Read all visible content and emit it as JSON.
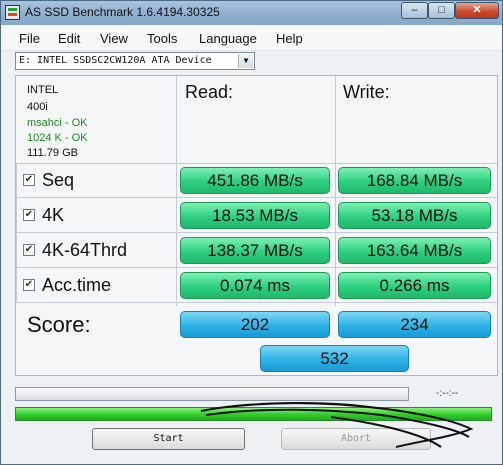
{
  "window": {
    "title": "AS SSD Benchmark 1.6.4194.30325",
    "controls": {
      "minimize": "–",
      "maximize": "□",
      "close": "✕"
    }
  },
  "menu": [
    "File",
    "Edit",
    "View",
    "Tools",
    "Language",
    "Help"
  ],
  "device_select": {
    "value": "E: INTEL SSDSC2CW120A ATA Device",
    "arrow": "▼"
  },
  "drive_info": {
    "vendor": "INTEL",
    "firmware": "400i",
    "driver_status": "msahci - OK",
    "alignment_status": "1024 K - OK",
    "capacity": "111.79 GB"
  },
  "columns": {
    "read": "Read:",
    "write": "Write:"
  },
  "rows": [
    {
      "label": "Seq",
      "checked": true,
      "read": "451.86 MB/s",
      "write": "168.84 MB/s"
    },
    {
      "label": "4K",
      "checked": true,
      "read": "18.53 MB/s",
      "write": "53.18 MB/s"
    },
    {
      "label": "4K-64Thrd",
      "checked": true,
      "read": "138.37 MB/s",
      "write": "163.64 MB/s"
    },
    {
      "label": "Acc.time",
      "checked": true,
      "read": "0.074 ms",
      "write": "0.266 ms"
    }
  ],
  "score": {
    "label": "Score:",
    "read": "202",
    "write": "234",
    "total": "532"
  },
  "progress": {
    "fraction": 0,
    "elapsed": "-:--:--"
  },
  "overall_progress": {
    "fraction": 1
  },
  "buttons": {
    "start": "Start",
    "abort": "Abort"
  },
  "colors": {
    "result_green": "#2ecf80",
    "score_blue": "#2eb3e6",
    "ok_green": "#1d8a1d"
  },
  "icons": {
    "checkbox": "check-icon",
    "app": "app-icon"
  }
}
